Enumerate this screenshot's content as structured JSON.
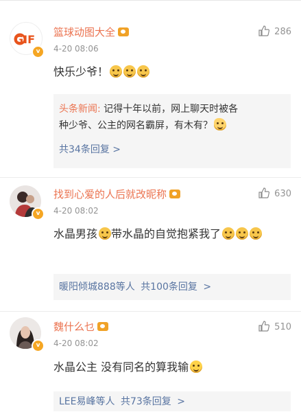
{
  "comments": [
    {
      "name": "篮球动图大全",
      "avatar_text": "GIF",
      "time": "4-20 08:06",
      "likes": "286",
      "text": "快乐少爷！",
      "reply": {
        "author": "头条新闻:",
        "line1": " 记得十年以前，网上聊天时被各",
        "line2": "种少爷、公主的网名霸屏，有木有？",
        "more": "共34条回复"
      }
    },
    {
      "name": "找到心爱的人后就改昵称",
      "time": "4-20 08:02",
      "likes": "630",
      "text_a": "水晶男孩",
      "text_b": "带水晶的自觉抱紧我了",
      "reply": {
        "names": "暖阳倾城888等人",
        "more": "共100条回复",
        "arrow": ">"
      }
    },
    {
      "name": "魏什么乜",
      "time": "4-20 08:02",
      "likes": "510",
      "text": "水晶公主 没有同名的算我输",
      "reply": {
        "names": "LEE易峰等人",
        "more": "共73条回复",
        "arrow": ">"
      }
    }
  ],
  "icons": {
    "like": "thumbs-up-icon",
    "verified": "verified-badge-icon",
    "level": "level-badge-icon"
  },
  "colors": {
    "name": "#eb7350",
    "link": "#5874a1",
    "meta": "#939393",
    "reply_bg": "#f5f5f5"
  }
}
